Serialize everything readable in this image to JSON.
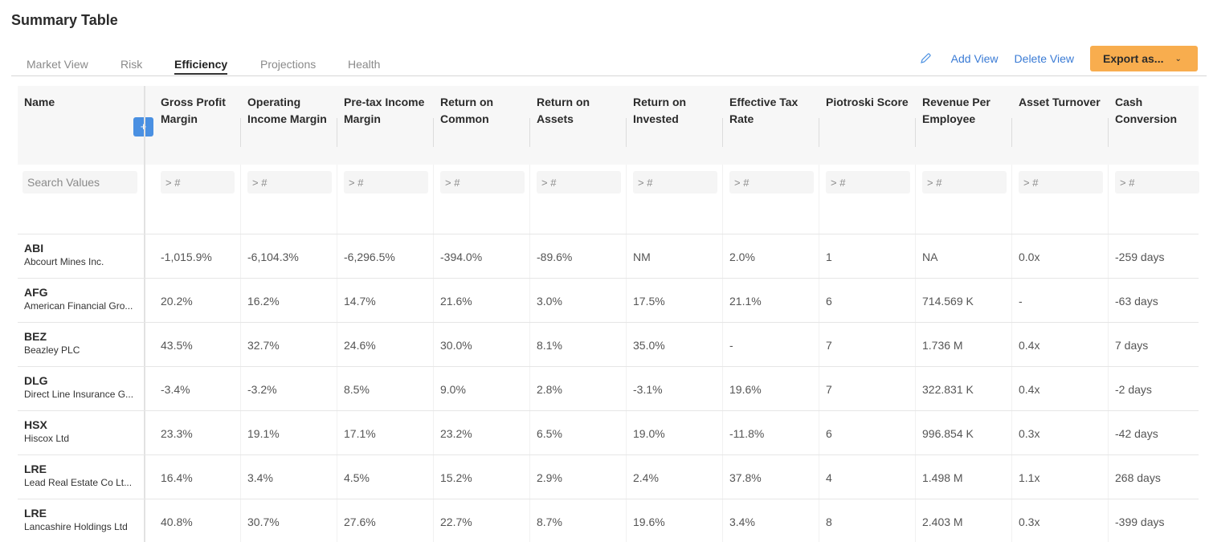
{
  "page": {
    "title": "Summary Table"
  },
  "tabs": [
    {
      "label": "Market View",
      "active": false
    },
    {
      "label": "Risk",
      "active": false
    },
    {
      "label": "Efficiency",
      "active": true
    },
    {
      "label": "Projections",
      "active": false
    },
    {
      "label": "Health",
      "active": false
    }
  ],
  "actions": {
    "edit_icon": "pencil-icon",
    "add_view": "Add View",
    "delete_view": "Delete View",
    "export_label": "Export as...",
    "export_icon": "chevron-down-icon"
  },
  "colors": {
    "accent": "#3a7bd5",
    "export": "#f8ad4e",
    "plus": "#4a90e2"
  },
  "table": {
    "name_header": "Name",
    "plus_label": "+",
    "name_filter_placeholder": "Search Values",
    "filter_placeholder": "> #",
    "columns": [
      {
        "line1": "Gross Profit",
        "line2": "Margin"
      },
      {
        "line1": "Operating",
        "line2": "Income Margin"
      },
      {
        "line1": "Pre-tax Income",
        "line2": "Margin"
      },
      {
        "line1": "Return on",
        "line2": "Common"
      },
      {
        "line1": "Return on",
        "line2": "Assets"
      },
      {
        "line1": "Return on",
        "line2": "Invested"
      },
      {
        "line1": "Effective Tax",
        "line2": "Rate"
      },
      {
        "line1": "Piotroski Score",
        "line2": ""
      },
      {
        "line1": "Revenue Per",
        "line2": "Employee"
      },
      {
        "line1": "Asset Turnover",
        "line2": ""
      },
      {
        "line1": "Cash",
        "line2": "Conversion"
      }
    ],
    "rows": [
      {
        "ticker": "ABI",
        "name": "Abcourt Mines Inc.",
        "values": [
          "-1,015.9%",
          "-6,104.3%",
          "-6,296.5%",
          "-394.0%",
          "-89.6%",
          "NM",
          "2.0%",
          "1",
          "NA",
          "0.0x",
          "-259 days"
        ]
      },
      {
        "ticker": "AFG",
        "name": "American Financial Gro...",
        "values": [
          "20.2%",
          "16.2%",
          "14.7%",
          "21.6%",
          "3.0%",
          "17.5%",
          "21.1%",
          "6",
          "714.569 K",
          "-",
          "-63 days"
        ]
      },
      {
        "ticker": "BEZ",
        "name": "Beazley PLC",
        "values": [
          "43.5%",
          "32.7%",
          "24.6%",
          "30.0%",
          "8.1%",
          "35.0%",
          "-",
          "7",
          "1.736 M",
          "0.4x",
          "7 days"
        ]
      },
      {
        "ticker": "DLG",
        "name": "Direct Line Insurance G...",
        "values": [
          "-3.4%",
          "-3.2%",
          "8.5%",
          "9.0%",
          "2.8%",
          "-3.1%",
          "19.6%",
          "7",
          "322.831 K",
          "0.4x",
          "-2 days"
        ]
      },
      {
        "ticker": "HSX",
        "name": "Hiscox Ltd",
        "values": [
          "23.3%",
          "19.1%",
          "17.1%",
          "23.2%",
          "6.5%",
          "19.0%",
          "-11.8%",
          "6",
          "996.854 K",
          "0.3x",
          "-42 days"
        ]
      },
      {
        "ticker": "LRE",
        "name": "Lead Real Estate Co Lt...",
        "values": [
          "16.4%",
          "3.4%",
          "4.5%",
          "15.2%",
          "2.9%",
          "2.4%",
          "37.8%",
          "4",
          "1.498 M",
          "1.1x",
          "268 days"
        ]
      },
      {
        "ticker": "LRE",
        "name": "Lancashire Holdings Ltd",
        "values": [
          "40.8%",
          "30.7%",
          "27.6%",
          "22.7%",
          "8.7%",
          "19.6%",
          "3.4%",
          "8",
          "2.403 M",
          "0.3x",
          "-399 days"
        ]
      }
    ]
  }
}
